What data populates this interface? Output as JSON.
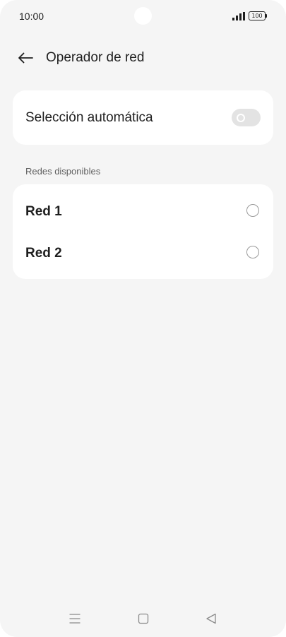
{
  "status_bar": {
    "time": "10:00",
    "battery_level": "100",
    "signal_icon": "signal-bars-icon"
  },
  "header": {
    "back_icon": "arrow-left-icon",
    "title": "Operador de red"
  },
  "automatic_selection": {
    "label": "Selección automática",
    "enabled": false
  },
  "networks_section": {
    "title": "Redes disponibles",
    "items": [
      {
        "label": "Red 1",
        "selected": false
      },
      {
        "label": "Red 2",
        "selected": false
      }
    ]
  },
  "nav_bar": {
    "menu_icon": "menu-icon",
    "home_icon": "home-square-icon",
    "back_icon": "back-triangle-icon"
  },
  "colors": {
    "background": "#f5f5f5",
    "card": "#ffffff",
    "text_primary": "#1f1f1f",
    "text_secondary": "#5f5f5f",
    "toggle_off": "#e3e3e3",
    "radio_border": "#9a9a9a"
  }
}
